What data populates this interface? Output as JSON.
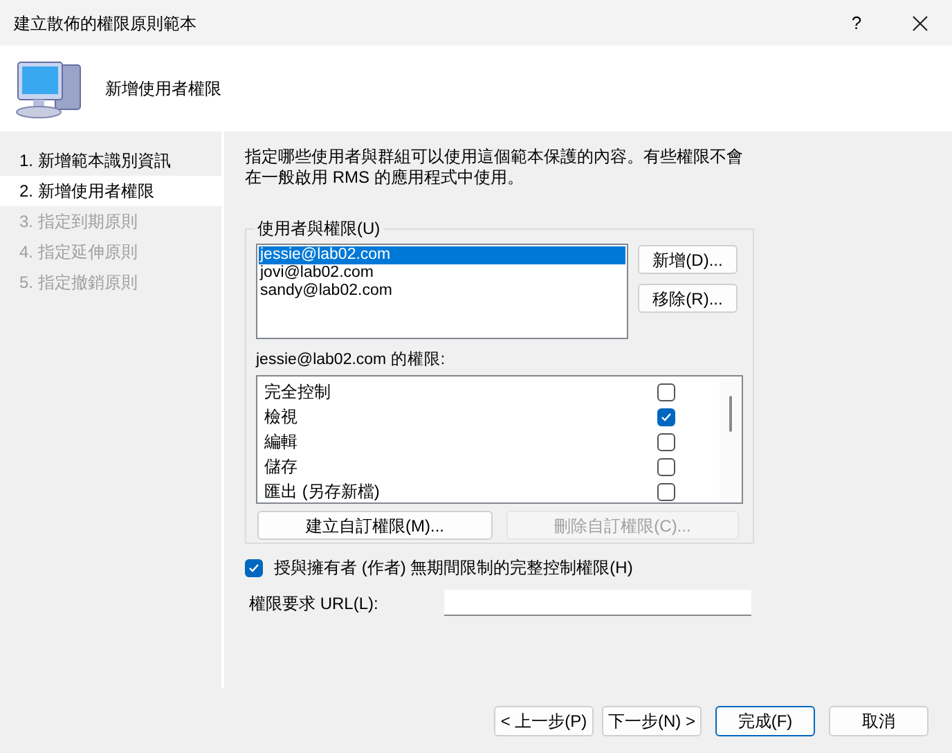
{
  "window": {
    "title": "建立散佈的權限原則範本",
    "help": "?"
  },
  "header": {
    "title": "新增使用者權限"
  },
  "steps": [
    {
      "label": "1. 新增範本識別資訊",
      "selected": false,
      "disabled": false
    },
    {
      "label": "2. 新增使用者權限",
      "selected": true,
      "disabled": false
    },
    {
      "label": "3. 指定到期原則",
      "selected": false,
      "disabled": true
    },
    {
      "label": "4. 指定延伸原則",
      "selected": false,
      "disabled": true
    },
    {
      "label": "5. 指定撤銷原則",
      "selected": false,
      "disabled": true
    }
  ],
  "description": "指定哪些使用者與群組可以使用這個範本保護的內容。有些權限不會在一般啟用 RMS 的應用程式中使用。",
  "users_group": {
    "legend": "使用者與權限(U)",
    "users": [
      {
        "email": "jessie@lab02.com",
        "selected": true
      },
      {
        "email": "jovi@lab02.com",
        "selected": false
      },
      {
        "email": "sandy@lab02.com",
        "selected": false
      }
    ],
    "add_button": "新增(D)...",
    "remove_button": "移除(R)...",
    "rights_label": "jessie@lab02.com 的權限:",
    "rights": [
      {
        "label": "完全控制",
        "checked": false
      },
      {
        "label": "檢視",
        "checked": true
      },
      {
        "label": "編輯",
        "checked": false
      },
      {
        "label": "儲存",
        "checked": false
      },
      {
        "label": "匯出 (另存新檔)",
        "checked": false
      }
    ],
    "create_button": {
      "label": "建立自訂權限(M)...",
      "disabled": false
    },
    "delete_button": {
      "label": "刪除自訂權限(C)...",
      "disabled": true
    }
  },
  "owner_rights": {
    "label": "授與擁有者 (作者) 無期間限制的完整控制權限(H)",
    "checked": true
  },
  "url": {
    "label": "權限要求 URL(L):"
  },
  "footer": [
    {
      "label": "< 上一步(P)",
      "default": false
    },
    {
      "label": "下一步(N) >",
      "default": false
    },
    {
      "label": "完成(F)",
      "default": true
    },
    {
      "label": "取消",
      "default": false
    }
  ]
}
